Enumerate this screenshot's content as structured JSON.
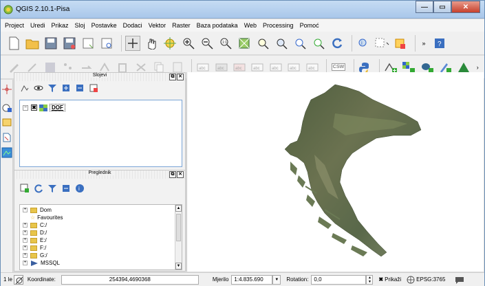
{
  "window": {
    "title": "QGIS 2.10.1-Pisa"
  },
  "menu": [
    "Project",
    "Uredi",
    "Prikaz",
    "Sloj",
    "Postavke",
    "Dodaci",
    "Vektor",
    "Raster",
    "Baza podataka",
    "Web",
    "Processing",
    "Pomoć"
  ],
  "toolbar2": {
    "csw_label": "CSW"
  },
  "layers_panel": {
    "title": "Slojevi",
    "layer": {
      "name": "DOF",
      "checked": "✖"
    }
  },
  "browser_panel": {
    "title": "Preglednik",
    "items": [
      "Dom",
      "Favourites",
      "C:/",
      "D:/",
      "E:/",
      "F:/",
      "G:/",
      "MSSQL"
    ]
  },
  "statusbar": {
    "lever": "1 le",
    "coord_label": "Koordinate:",
    "coord_value": "254394,4690368",
    "scale_label": "Mjerilo",
    "scale_value": "1:4.835.690",
    "rotation_label": "Rotation:",
    "rotation_value": "0,0",
    "render_label": "Prikaži",
    "crs": "EPSG:3765"
  },
  "colors": {
    "accent": "#4a7fc1",
    "titlebar": "#b9d2ef"
  }
}
